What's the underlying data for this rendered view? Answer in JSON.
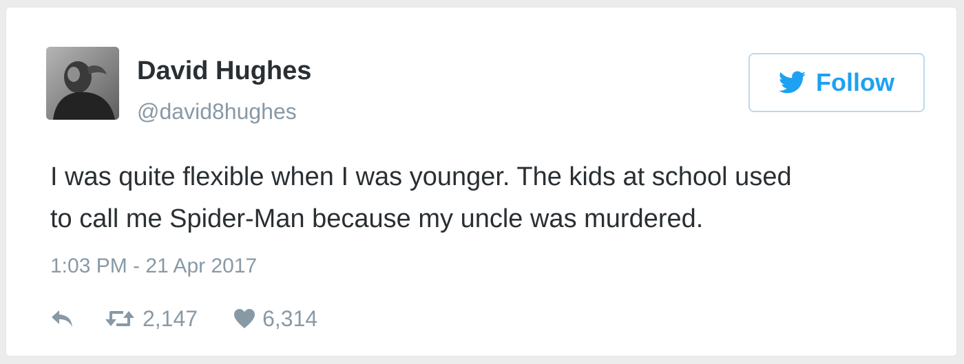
{
  "tweet": {
    "author": {
      "name": "David Hughes",
      "handle": "@david8hughes",
      "avatar_icon": "avatar-photo"
    },
    "follow_button": {
      "label": "Follow",
      "icon": "twitter-bird-icon",
      "color": "#1da1f2"
    },
    "text_lines": [
      "I was quite flexible when I was younger. The kids at school used",
      "to call me Spider-Man because my uncle was murdered."
    ],
    "timestamp": "1:03 PM - 21 Apr 2017",
    "actions": {
      "reply_icon": "reply-icon",
      "retweet_icon": "retweet-icon",
      "retweet_count": "2,147",
      "like_icon": "heart-icon",
      "like_count": "6,314"
    },
    "colors": {
      "text": "#292f33",
      "secondary": "#8899a6",
      "accent": "#1da1f2"
    }
  }
}
